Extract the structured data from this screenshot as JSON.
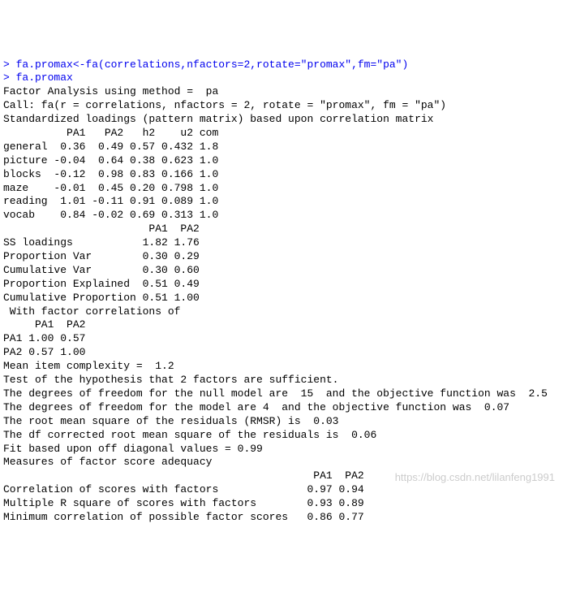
{
  "lines": [
    {
      "prompt": true,
      "text": "> fa.promax<-fa(correlations,nfactors=2,rotate=\"promax\",fm=\"pa\")"
    },
    {
      "prompt": true,
      "text": "> fa.promax"
    },
    {
      "prompt": false,
      "text": "Factor Analysis using method =  pa"
    },
    {
      "prompt": false,
      "text": "Call: fa(r = correlations, nfactors = 2, rotate = \"promax\", fm = \"pa\")"
    },
    {
      "prompt": false,
      "text": "Standardized loadings (pattern matrix) based upon correlation matrix"
    },
    {
      "prompt": false,
      "text": "          PA1   PA2   h2    u2 com"
    },
    {
      "prompt": false,
      "text": "general  0.36  0.49 0.57 0.432 1.8"
    },
    {
      "prompt": false,
      "text": "picture -0.04  0.64 0.38 0.623 1.0"
    },
    {
      "prompt": false,
      "text": "blocks  -0.12  0.98 0.83 0.166 1.0"
    },
    {
      "prompt": false,
      "text": "maze    -0.01  0.45 0.20 0.798 1.0"
    },
    {
      "prompt": false,
      "text": "reading  1.01 -0.11 0.91 0.089 1.0"
    },
    {
      "prompt": false,
      "text": "vocab    0.84 -0.02 0.69 0.313 1.0"
    },
    {
      "prompt": false,
      "text": ""
    },
    {
      "prompt": false,
      "text": "                       PA1  PA2"
    },
    {
      "prompt": false,
      "text": "SS loadings           1.82 1.76"
    },
    {
      "prompt": false,
      "text": "Proportion Var        0.30 0.29"
    },
    {
      "prompt": false,
      "text": "Cumulative Var        0.30 0.60"
    },
    {
      "prompt": false,
      "text": "Proportion Explained  0.51 0.49"
    },
    {
      "prompt": false,
      "text": "Cumulative Proportion 0.51 1.00"
    },
    {
      "prompt": false,
      "text": ""
    },
    {
      "prompt": false,
      "text": " With factor correlations of "
    },
    {
      "prompt": false,
      "text": "     PA1  PA2"
    },
    {
      "prompt": false,
      "text": "PA1 1.00 0.57"
    },
    {
      "prompt": false,
      "text": "PA2 0.57 1.00"
    },
    {
      "prompt": false,
      "text": ""
    },
    {
      "prompt": false,
      "text": "Mean item complexity =  1.2"
    },
    {
      "prompt": false,
      "text": "Test of the hypothesis that 2 factors are sufficient."
    },
    {
      "prompt": false,
      "text": ""
    },
    {
      "prompt": false,
      "text": "The degrees of freedom for the null model are  15  and the objective function was  2.5"
    },
    {
      "prompt": false,
      "text": "The degrees of freedom for the model are 4  and the objective function was  0.07 "
    },
    {
      "prompt": false,
      "text": ""
    },
    {
      "prompt": false,
      "text": "The root mean square of the residuals (RMSR) is  0.03 "
    },
    {
      "prompt": false,
      "text": "The df corrected root mean square of the residuals is  0.06 "
    },
    {
      "prompt": false,
      "text": ""
    },
    {
      "prompt": false,
      "text": "Fit based upon off diagonal values = 0.99"
    },
    {
      "prompt": false,
      "text": "Measures of factor score adequacy             "
    },
    {
      "prompt": false,
      "text": "                                                 PA1  PA2"
    },
    {
      "prompt": false,
      "text": "Correlation of scores with factors              0.97 0.94"
    },
    {
      "prompt": false,
      "text": "Multiple R square of scores with factors        0.93 0.89"
    },
    {
      "prompt": false,
      "text": "Minimum correlation of possible factor scores   0.86 0.77"
    }
  ],
  "chart_data": {
    "type": "table",
    "title": "Factor Analysis - Standardized loadings (pattern matrix)",
    "loadings": {
      "columns": [
        "PA1",
        "PA2",
        "h2",
        "u2",
        "com"
      ],
      "rows": [
        {
          "name": "general",
          "values": [
            0.36,
            0.49,
            0.57,
            0.432,
            1.8
          ]
        },
        {
          "name": "picture",
          "values": [
            -0.04,
            0.64,
            0.38,
            0.623,
            1.0
          ]
        },
        {
          "name": "blocks",
          "values": [
            -0.12,
            0.98,
            0.83,
            0.166,
            1.0
          ]
        },
        {
          "name": "maze",
          "values": [
            -0.01,
            0.45,
            0.2,
            0.798,
            1.0
          ]
        },
        {
          "name": "reading",
          "values": [
            1.01,
            -0.11,
            0.91,
            0.089,
            1.0
          ]
        },
        {
          "name": "vocab",
          "values": [
            0.84,
            -0.02,
            0.69,
            0.313,
            1.0
          ]
        }
      ]
    },
    "variance": {
      "columns": [
        "PA1",
        "PA2"
      ],
      "rows": [
        {
          "name": "SS loadings",
          "values": [
            1.82,
            1.76
          ]
        },
        {
          "name": "Proportion Var",
          "values": [
            0.3,
            0.29
          ]
        },
        {
          "name": "Cumulative Var",
          "values": [
            0.3,
            0.6
          ]
        },
        {
          "name": "Proportion Explained",
          "values": [
            0.51,
            0.49
          ]
        },
        {
          "name": "Cumulative Proportion",
          "values": [
            0.51,
            1.0
          ]
        }
      ]
    },
    "factor_correlations": {
      "columns": [
        "PA1",
        "PA2"
      ],
      "rows": [
        {
          "name": "PA1",
          "values": [
            1.0,
            0.57
          ]
        },
        {
          "name": "PA2",
          "values": [
            0.57,
            1.0
          ]
        }
      ]
    },
    "fit_stats": {
      "mean_item_complexity": 1.2,
      "null_model_df": 15,
      "null_model_objective": 2.5,
      "model_df": 4,
      "model_objective": 0.07,
      "rmsr": 0.03,
      "df_corrected_rmsr": 0.06,
      "off_diagonal_fit": 0.99
    },
    "score_adequacy": {
      "columns": [
        "PA1",
        "PA2"
      ],
      "rows": [
        {
          "name": "Correlation of scores with factors",
          "values": [
            0.97,
            0.94
          ]
        },
        {
          "name": "Multiple R square of scores with factors",
          "values": [
            0.93,
            0.89
          ]
        },
        {
          "name": "Minimum correlation of possible factor scores",
          "values": [
            0.86,
            0.77
          ]
        }
      ]
    }
  },
  "watermark": "https://blog.csdn.net/lilanfeng1991"
}
